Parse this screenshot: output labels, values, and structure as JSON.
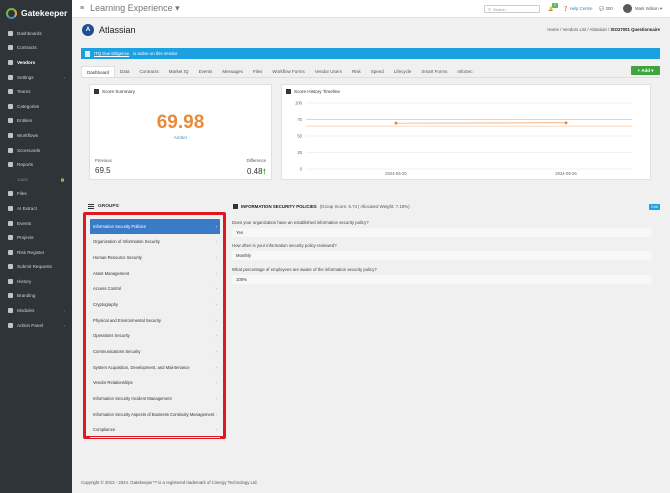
{
  "brand": {
    "name": "Gatekeeper"
  },
  "sidebar": {
    "items": [
      {
        "label": "Dashboards",
        "icon": "dashboard-icon"
      },
      {
        "label": "Contracts",
        "icon": "contract-icon"
      },
      {
        "label": "Vendors",
        "icon": "vendor-icon",
        "active": true
      },
      {
        "label": "Settings",
        "icon": "gear-icon",
        "arrow": "›"
      },
      {
        "label": "Teams",
        "icon": "team-icon"
      },
      {
        "label": "Categories",
        "icon": "category-icon"
      },
      {
        "label": "Entities",
        "icon": "entity-icon"
      },
      {
        "label": "Workflows",
        "icon": "workflow-icon"
      },
      {
        "label": "Scorecards",
        "icon": "scorecard-icon"
      },
      {
        "label": "Reports",
        "icon": "report-icon"
      },
      {
        "label": "Locs",
        "icon": "lock-icon",
        "locked": true
      },
      {
        "label": "Files",
        "icon": "file-icon"
      },
      {
        "label": "AI Extract",
        "icon": "ai-icon"
      },
      {
        "label": "Events",
        "icon": "event-icon"
      },
      {
        "label": "Projects",
        "icon": "project-icon"
      },
      {
        "label": "Risk Register",
        "icon": "risk-icon"
      },
      {
        "label": "Submit Requests",
        "icon": "request-icon"
      },
      {
        "label": "History",
        "icon": "history-icon"
      },
      {
        "label": "Branding",
        "icon": "branding-icon"
      },
      {
        "label": "Modules",
        "icon": "module-icon",
        "arrow": "›"
      },
      {
        "label": "Admin Panel",
        "icon": "admin-icon",
        "arrow": "›"
      }
    ]
  },
  "topbar": {
    "title": "Learning Experience",
    "search_placeholder": "Search",
    "notification_count": "2",
    "help_label": "Help Centre",
    "chat_label": "200",
    "user_name": "Mark Wilson"
  },
  "page": {
    "company": "Atlassian",
    "company_initial": "A",
    "breadcrumb": {
      "home": "Home",
      "sep": "/",
      "list": "Vendors List",
      "vendor": "Atlassian",
      "current": "ISO27001 Questionnaire"
    },
    "banner": {
      "link": "ITQ Due Diligence",
      "text": "is active on this Vendor"
    },
    "tabs": [
      "Dashboard",
      "Data",
      "Contracts",
      "Market IQ",
      "Events",
      "Messages",
      "Files",
      "Workflow Forms",
      "Vendor Users",
      "Risk",
      "Spend",
      "Lifecycle",
      "Smart Forms",
      "InfoSec"
    ],
    "active_tab": "Dashboard",
    "add_label": "+ Add ▾"
  },
  "score_summary": {
    "title": "Score Summary",
    "score": "69.98",
    "rating": "Amber",
    "previous_label": "Previous",
    "previous_value": "69.5",
    "difference_label": "Difference",
    "difference_value": "0.48",
    "difference_icon": "arrow-up-icon",
    "rating_color": "#ec8a3a"
  },
  "chart_data": {
    "type": "line",
    "title": "Score History Timeline",
    "x": [
      "2024-05-20",
      "2024-09-26"
    ],
    "series": [
      {
        "values": [
          69.5,
          69.98
        ]
      }
    ],
    "ylim": [
      0,
      100
    ],
    "yticks": [
      0,
      25,
      50,
      75,
      100
    ],
    "reference_lines": [
      75,
      65
    ],
    "grid": true,
    "line_color": "#ec8a3a"
  },
  "groups": {
    "title": "GROUPS",
    "items": [
      "Information Security Policies",
      "Organization of Information Security",
      "Human Resource Security",
      "Asset Management",
      "Access Control",
      "Cryptography",
      "Physical and Environmental Security",
      "Operations Security",
      "Communications Security",
      "System Acquisition, Development, and Maintenance",
      "Vendor Relationships",
      "Information Security Incident Management",
      "Information Security Aspects of Business Continuity Management",
      "Compliance"
    ],
    "active_index": 0
  },
  "questions": {
    "group_title": "INFORMATION SECURITY POLICIES",
    "group_meta": "(Group Score: 5.74  |  Allocated Weight: 7.19%)",
    "edit_label": "Edit",
    "items": [
      {
        "q": "Does your organization have an established information security policy?",
        "a": "Yes"
      },
      {
        "q": "How often is your information security policy reviewed?",
        "a": "Monthly"
      },
      {
        "q": "What percentage of employees are aware of the information security policy?",
        "a": "100%"
      }
    ]
  },
  "footer": {
    "text": "Copyright © 2013 - 2024. Gatekeeper™ is a registered trademark of Cinergy Technology Ltd."
  },
  "colors": {
    "accent": "#3a7bc8",
    "banner": "#1ba1e2",
    "add_button": "#3fa43f",
    "highlight": "#e0171e",
    "sidebar": "#2f3438"
  }
}
